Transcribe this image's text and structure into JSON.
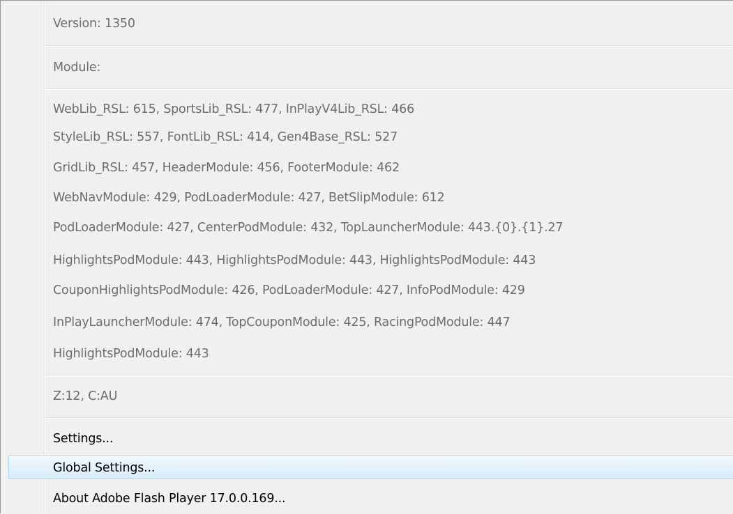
{
  "menu": {
    "version": "Version: 1350",
    "module_header": "Module:",
    "module_lines": [
      "WebLib_RSL: 615, SportsLib_RSL: 477, InPlayV4Lib_RSL: 466",
      "StyleLib_RSL: 557, FontLib_RSL: 414, Gen4Base_RSL: 527",
      "GridLib_RSL: 457, HeaderModule: 456, FooterModule: 462",
      "WebNavModule: 429, PodLoaderModule: 427, BetSlipModule: 612",
      "PodLoaderModule: 427, CenterPodModule: 432, TopLauncherModule: 443.{0}.{1}.27",
      "HighlightsPodModule: 443, HighlightsPodModule: 443, HighlightsPodModule: 443",
      "CouponHighlightsPodModule: 426, PodLoaderModule: 427, InfoPodModule: 429",
      "InPlayLauncherModule: 474, TopCouponModule: 425, RacingPodModule: 447",
      "HighlightsPodModule: 443"
    ],
    "zc": "Z:12, C:AU",
    "settings": "Settings...",
    "global_settings": "Global Settings...",
    "about": "About Adobe Flash Player 17.0.0.169..."
  }
}
